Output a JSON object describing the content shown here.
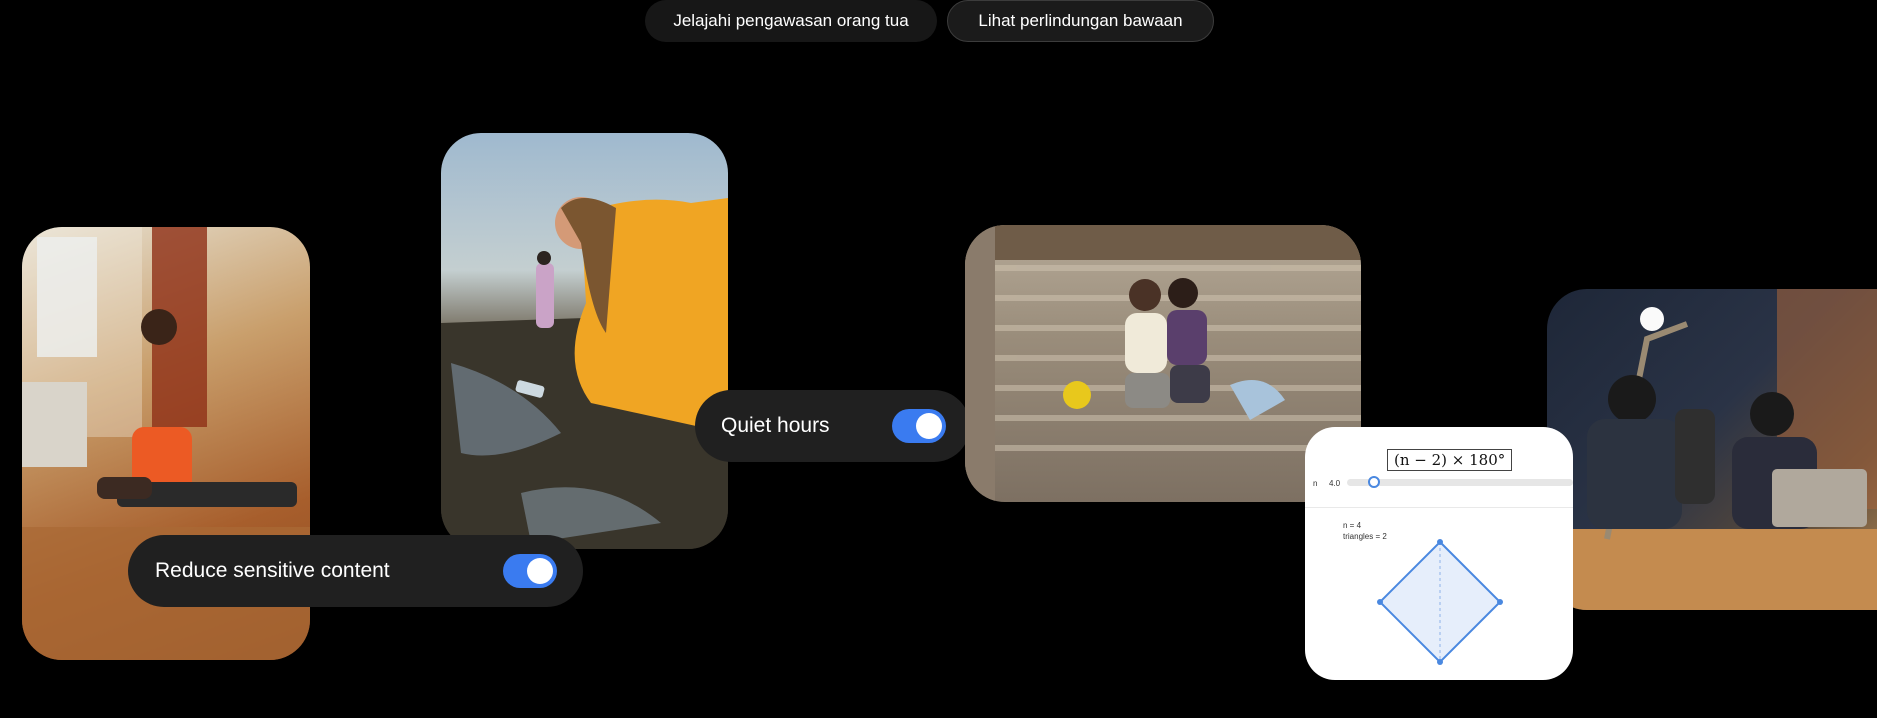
{
  "buttons": {
    "explore_label": "Jelajahi pengawasan orang tua",
    "protection_label": "Lihat perlindungan bawaan"
  },
  "toggles": {
    "quiet_hours": {
      "label": "Quiet hours",
      "on": true
    },
    "reduce_sensitive": {
      "label": "Reduce sensitive content",
      "on": true
    }
  },
  "math_widget": {
    "formula": "(n − 2) × 180°",
    "slider_name": "n",
    "slider_value": "4.0",
    "slider_fraction": 0.12,
    "info_n": "n = 4",
    "info_triangles": "triangles = 2"
  },
  "colors": {
    "accent": "#3a7bf0",
    "card_bg": "#202020",
    "page_bg": "#000000"
  }
}
